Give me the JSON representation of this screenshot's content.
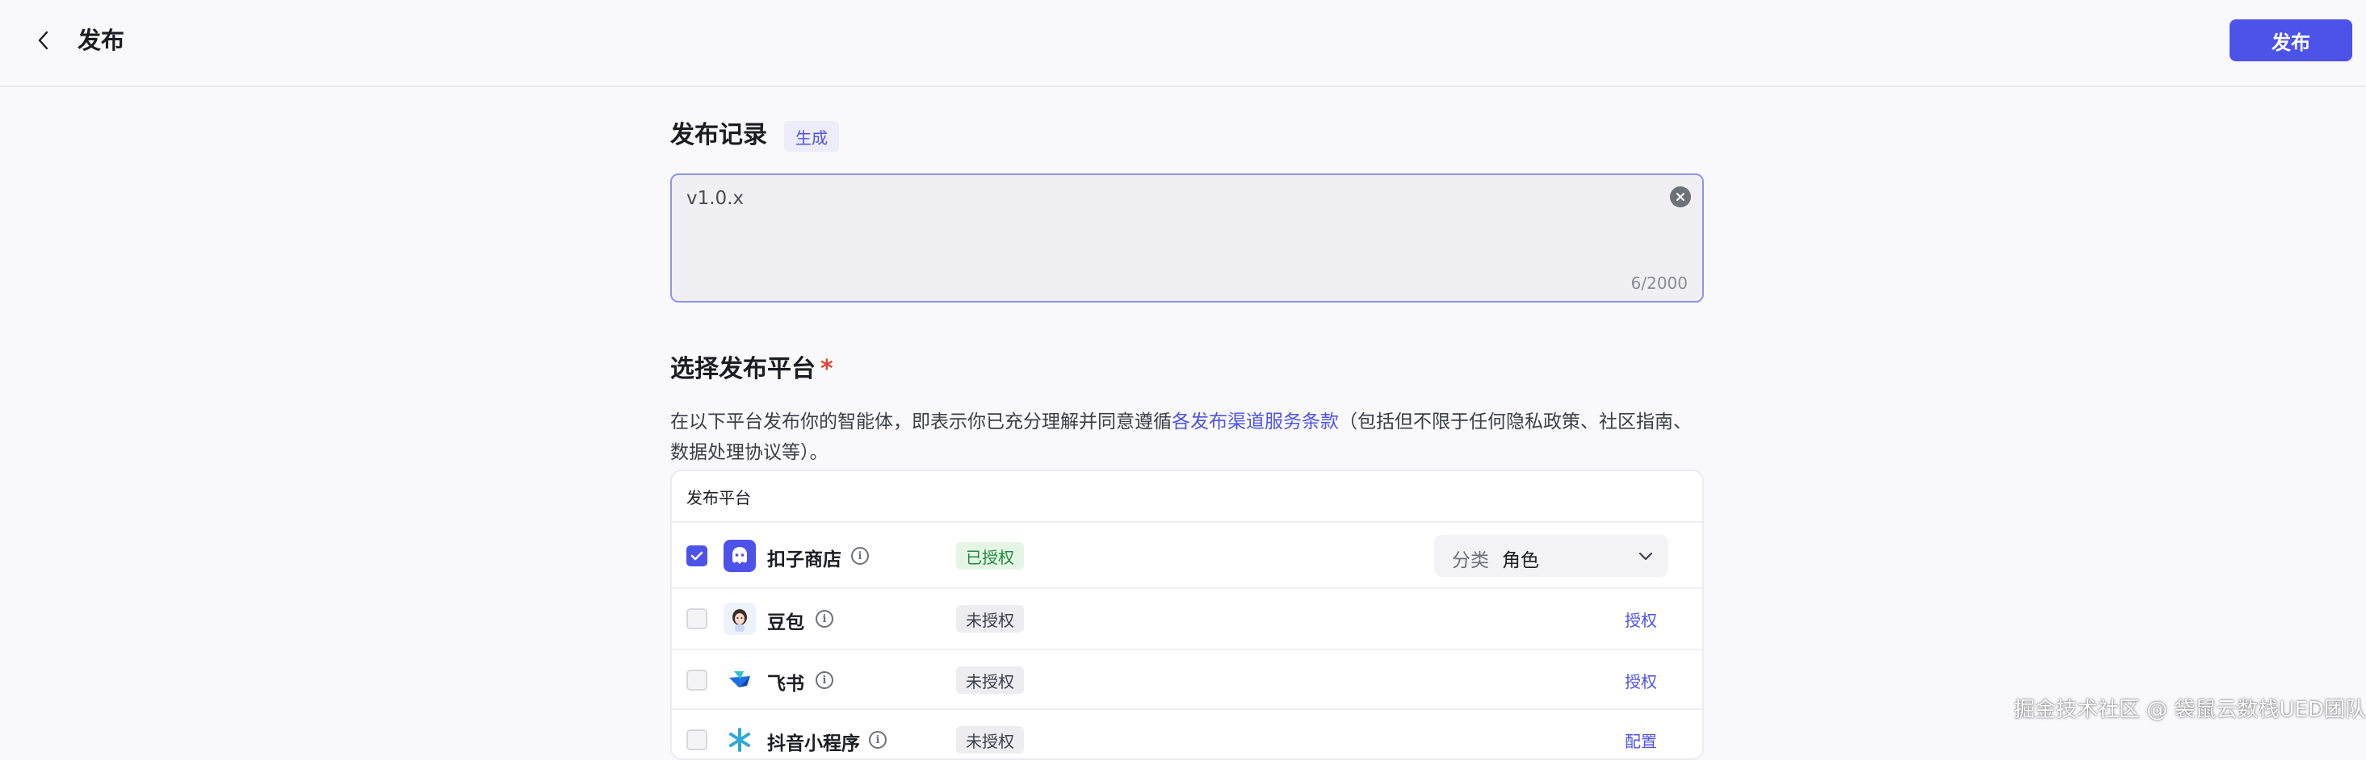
{
  "header": {
    "title": "发布",
    "publish_label": "发布"
  },
  "record": {
    "title": "发布记录",
    "generate_label": "生成",
    "value": "v1.0.x",
    "count": "6/2000"
  },
  "platform_section": {
    "title": "选择发布平台",
    "required_mark": "*",
    "desc_before": "在以下平台发布你的智能体，即表示你已充分理解并同意遵循",
    "desc_link": "各发布渠道服务条款",
    "desc_after": "（包括但不限于任何隐私政策、社区指南、数据处理协议等）。",
    "table_header": "发布平台",
    "rows": [
      {
        "name": "扣子商店",
        "status": "已授权",
        "checked": true,
        "category_label": "分类",
        "category_value": "角色"
      },
      {
        "name": "豆包",
        "status": "未授权",
        "checked": false,
        "action": "授权"
      },
      {
        "name": "飞书",
        "status": "未授权",
        "checked": false,
        "action": "授权"
      },
      {
        "name": "抖音小程序",
        "status": "未授权",
        "checked": false,
        "action": "配置"
      }
    ]
  },
  "watermark": "掘金技术社区 @ 袋鼠云数栈UED团队",
  "colors": {
    "accent": "#4d53e8",
    "authorized_bg": "#e4f5e6",
    "authorized_text": "#1f8a3a",
    "required": "#e0453a"
  }
}
